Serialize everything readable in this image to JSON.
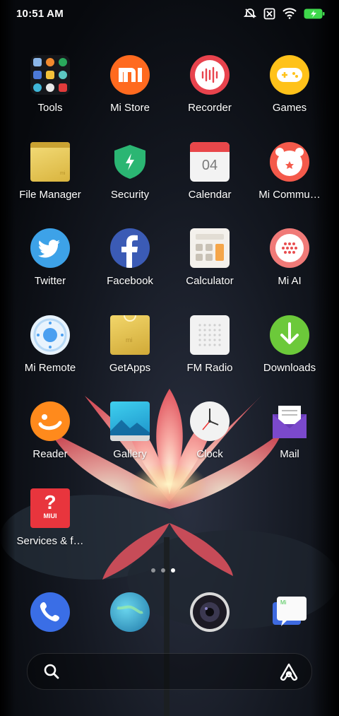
{
  "status": {
    "time": "10:51 AM",
    "icons": [
      "alarm-off-icon",
      "no-sim-icon",
      "wifi-icon",
      "battery-charging-icon"
    ]
  },
  "apps": [
    {
      "label": "Tools",
      "icon": "tools-folder-icon"
    },
    {
      "label": "Mi Store",
      "icon": "mi-store-icon"
    },
    {
      "label": "Recorder",
      "icon": "recorder-icon"
    },
    {
      "label": "Games",
      "icon": "games-icon"
    },
    {
      "label": "File Manager",
      "icon": "file-manager-icon"
    },
    {
      "label": "Security",
      "icon": "security-shield-icon"
    },
    {
      "label": "Calendar",
      "icon": "calendar-icon",
      "day": "04"
    },
    {
      "label": "Mi Commu…",
      "icon": "mi-community-icon"
    },
    {
      "label": "Twitter",
      "icon": "twitter-icon"
    },
    {
      "label": "Facebook",
      "icon": "facebook-icon"
    },
    {
      "label": "Calculator",
      "icon": "calculator-icon"
    },
    {
      "label": "Mi AI",
      "icon": "mi-ai-icon"
    },
    {
      "label": "Mi Remote",
      "icon": "mi-remote-icon"
    },
    {
      "label": "GetApps",
      "icon": "getapps-icon"
    },
    {
      "label": "FM Radio",
      "icon": "fm-radio-icon"
    },
    {
      "label": "Downloads",
      "icon": "downloads-icon"
    },
    {
      "label": "Reader",
      "icon": "reader-icon"
    },
    {
      "label": "Gallery",
      "icon": "gallery-icon"
    },
    {
      "label": "Clock",
      "icon": "clock-icon"
    },
    {
      "label": "Mail",
      "icon": "mail-icon"
    },
    {
      "label": "Services & f…",
      "icon": "services-feedback-icon",
      "badge": "MIUI"
    }
  ],
  "page_indicator": {
    "pages": 3,
    "current": 3
  },
  "dock": [
    {
      "icon": "phone-icon"
    },
    {
      "icon": "browser-icon"
    },
    {
      "icon": "camera-icon"
    },
    {
      "icon": "messaging-icon"
    }
  ],
  "search": {
    "left_icon": "search-icon",
    "right_icon": "assistant-icon"
  },
  "colors": {
    "mi_orange": "#ff6a1f",
    "recorder_red": "#e8434d",
    "games_yellow": "#ffc21a",
    "security_green": "#2bb673",
    "downloads_green": "#6cc93a",
    "twitter_blue": "#3da2e8",
    "facebook_blue": "#3b5bb5",
    "mail_purple": "#6a3db8"
  }
}
